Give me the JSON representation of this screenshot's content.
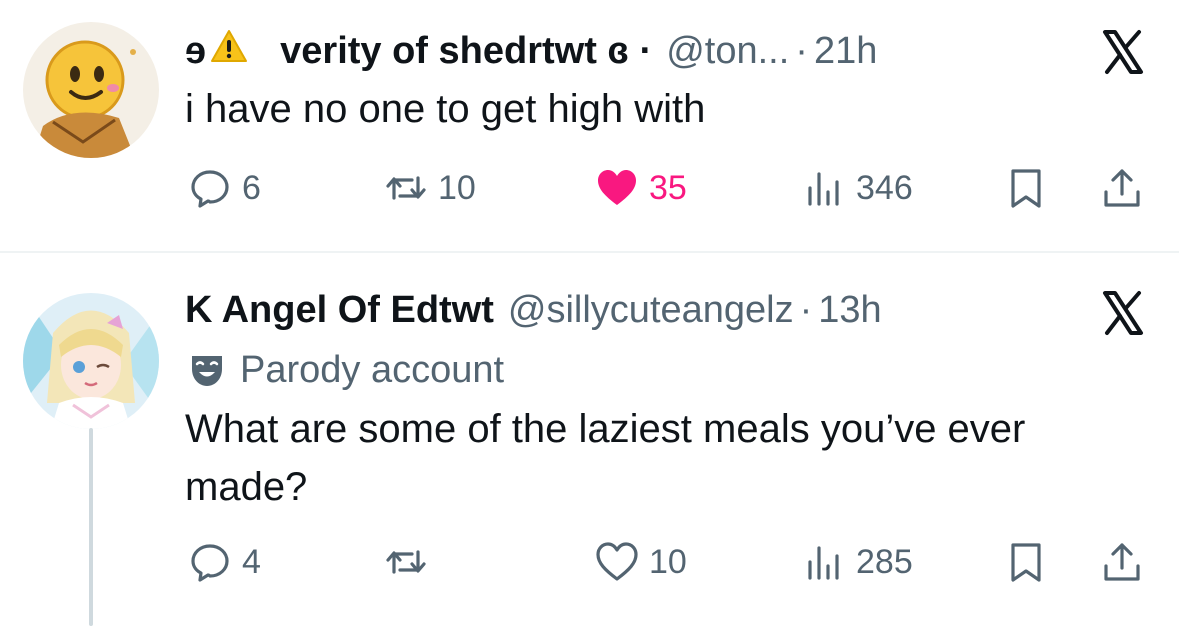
{
  "tweets": [
    {
      "name_prefix": "ɘ",
      "warning_emoji": "⚠",
      "name": "verity of shedrtwt ɞ ·",
      "handle": "@ton...",
      "time": "21h",
      "text": "i have no one to get high with",
      "replies": "6",
      "retweets": "10",
      "likes": "35",
      "liked": true,
      "views": "346"
    },
    {
      "name": "K Angel Of Edtwt",
      "handle": "@sillycuteangelz",
      "time": "13h",
      "label": "Parody account",
      "text": "What are some of the laziest meals you’ve ever made?",
      "replies": "4",
      "retweets": "",
      "likes": "10",
      "liked": false,
      "views": "285"
    }
  ],
  "colors": {
    "text": "#0f1419",
    "secondary": "#536471",
    "like_active": "#f91880",
    "divider": "#eff3f4",
    "thread_line": "#cfd9de"
  },
  "icons": {
    "reply": "reply-icon",
    "retweet": "retweet-icon",
    "like": "heart-icon",
    "views": "views-icon",
    "bookmark": "bookmark-icon",
    "share": "share-icon",
    "platform": "x-logo-icon",
    "parody": "parody-mask-icon"
  }
}
